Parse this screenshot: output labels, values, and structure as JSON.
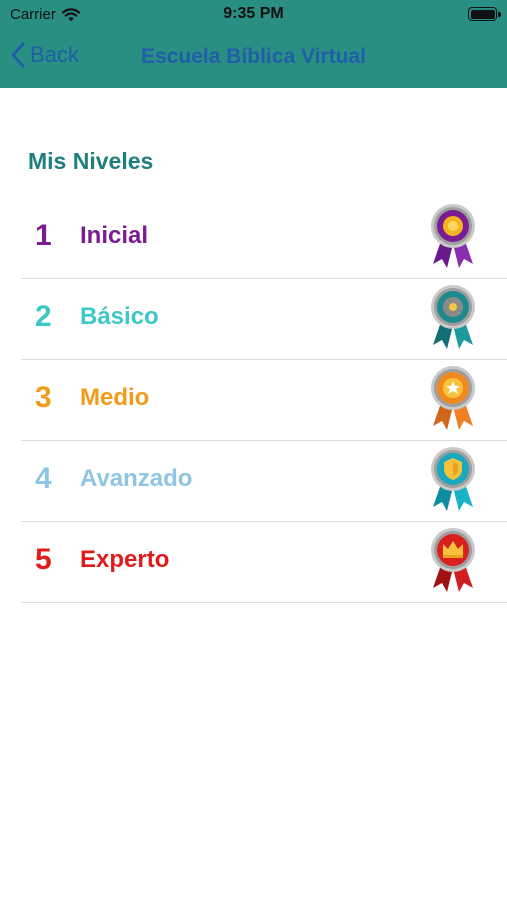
{
  "status_bar": {
    "carrier": "Carrier",
    "time": "9:35 PM"
  },
  "nav": {
    "back_label": "Back",
    "title": "Escuela Bíblica Virtual"
  },
  "section_title": "Mis Niveles",
  "levels": [
    {
      "number": "1",
      "label": "Inicial",
      "color": "#7b1c93",
      "medal": "purple-flower-medal-icon"
    },
    {
      "number": "2",
      "label": "Básico",
      "color": "#3cc9c6",
      "medal": "teal-gear-medal-icon"
    },
    {
      "number": "3",
      "label": "Medio",
      "color": "#f29a1a",
      "medal": "orange-star-medal-icon"
    },
    {
      "number": "4",
      "label": "Avanzado",
      "color": "#8fc7e3",
      "medal": "cyan-shield-medal-icon"
    },
    {
      "number": "5",
      "label": "Experto",
      "color": "#e01b1b",
      "medal": "red-crown-medal-icon"
    }
  ],
  "colors": {
    "header_bg": "#2a8f83",
    "nav_text": "#1f5ea8",
    "section_title": "#1f7f7c"
  }
}
